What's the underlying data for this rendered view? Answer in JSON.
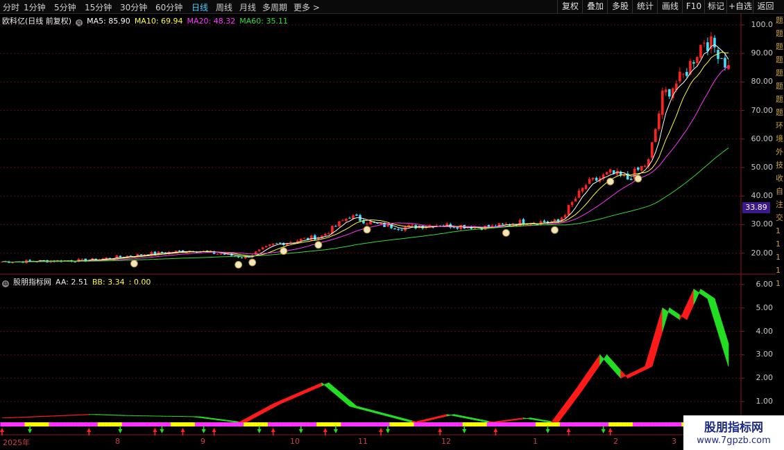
{
  "toolbar": {
    "periods": [
      {
        "label": "分时",
        "x": 4
      },
      {
        "label": "1分钟",
        "x": 34
      },
      {
        "label": "5分钟",
        "x": 78
      },
      {
        "label": "15分钟",
        "x": 122
      },
      {
        "label": "30分钟",
        "x": 173
      },
      {
        "label": "60分钟",
        "x": 224
      },
      {
        "label": "日线",
        "x": 276
      },
      {
        "label": "周线",
        "x": 311
      },
      {
        "label": "月线",
        "x": 345
      },
      {
        "label": "多周期",
        "x": 378
      },
      {
        "label": "更多 >",
        "x": 423
      }
    ],
    "active_period": "日线",
    "buttons": [
      {
        "label": "复权",
        "x": 803,
        "w": 36
      },
      {
        "label": "叠加",
        "x": 839,
        "w": 36
      },
      {
        "label": "多股",
        "x": 875,
        "w": 36
      },
      {
        "label": "统计",
        "x": 911,
        "w": 36
      },
      {
        "label": "画线",
        "x": 947,
        "w": 36
      },
      {
        "label": "F10",
        "x": 983,
        "w": 32
      },
      {
        "label": "标记",
        "x": 1015,
        "w": 32
      },
      {
        "label": "+自选",
        "x": 1047,
        "w": 38
      },
      {
        "label": "返回",
        "x": 1085,
        "w": 35
      }
    ]
  },
  "price_panel": {
    "title": "欧科亿(日线 前复权)",
    "ma": [
      {
        "label": "MA5: 85.90",
        "color": "#ffffff"
      },
      {
        "label": "MA10: 69.94",
        "color": "#ffff33"
      },
      {
        "label": "MA20: 48.32",
        "color": "#ff33ff"
      },
      {
        "label": "MA60: 35.11",
        "color": "#33dd33"
      }
    ],
    "y_ticks": [
      "100.0",
      "90.00",
      "80.00",
      "70.00",
      "60.00",
      "50.00",
      "40.00",
      "30.00",
      "20.00"
    ],
    "current_price": "33.89"
  },
  "indicator_panel": {
    "title": "股朋指标网",
    "aa": "AA: 2.51",
    "bb": "BB: 3.34",
    "cc": ": 0.00",
    "y_ticks": [
      "6.00",
      "5.00",
      "4.00",
      "3.00",
      "2.00",
      "1.00"
    ]
  },
  "x_axis": [
    {
      "label": "2025年",
      "x": 4
    },
    {
      "label": "8",
      "x": 166
    },
    {
      "label": "9",
      "x": 289
    },
    {
      "label": "10",
      "x": 418
    },
    {
      "label": "11",
      "x": 516
    },
    {
      "label": "12",
      "x": 636
    },
    {
      "label": "1",
      "x": 768
    },
    {
      "label": "2",
      "x": 884
    },
    {
      "label": "3",
      "x": 968
    }
  ],
  "watermark": {
    "line1": "股朋指标网",
    "line2": "www.7gpzb.com"
  },
  "side_text": "题 题 题 题 题 题 题 题 环 境 外 技 收 自 注 交 1 1 1 1 1",
  "colors": {
    "up": "#ff2020",
    "down": "#40e0ff",
    "bull": "#ff1a1a",
    "bear": "#22dd22",
    "strip_a": "#ff33ff",
    "strip_b": "#ffff00"
  }
}
